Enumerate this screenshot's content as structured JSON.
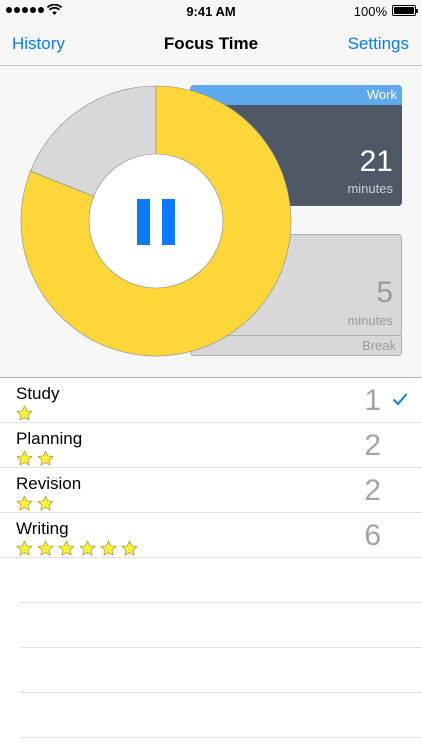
{
  "status_bar": {
    "time": "9:41 AM",
    "battery_percent": "100%",
    "signal_bars": 5
  },
  "nav": {
    "left_label": "History",
    "title": "Focus Time",
    "right_label": "Settings"
  },
  "timer": {
    "work": {
      "label": "Work",
      "value": "21",
      "unit": "minutes"
    },
    "break": {
      "label": "Break",
      "value": "5",
      "unit": "minutes"
    },
    "donut": {
      "completed_fraction": 0.81,
      "completed_color": "#fdd73a",
      "remaining_color": "#d8d8d8"
    },
    "pause_color": "#0a7aff"
  },
  "tasks": [
    {
      "name": "Study",
      "stars": 1,
      "count": "1",
      "selected": true
    },
    {
      "name": "Planning",
      "stars": 2,
      "count": "2",
      "selected": false
    },
    {
      "name": "Revision",
      "stars": 2,
      "count": "2",
      "selected": false
    },
    {
      "name": "Writing",
      "stars": 6,
      "count": "6",
      "selected": false
    }
  ],
  "colors": {
    "accent": "#0a7aff",
    "star": "#fff23c"
  }
}
